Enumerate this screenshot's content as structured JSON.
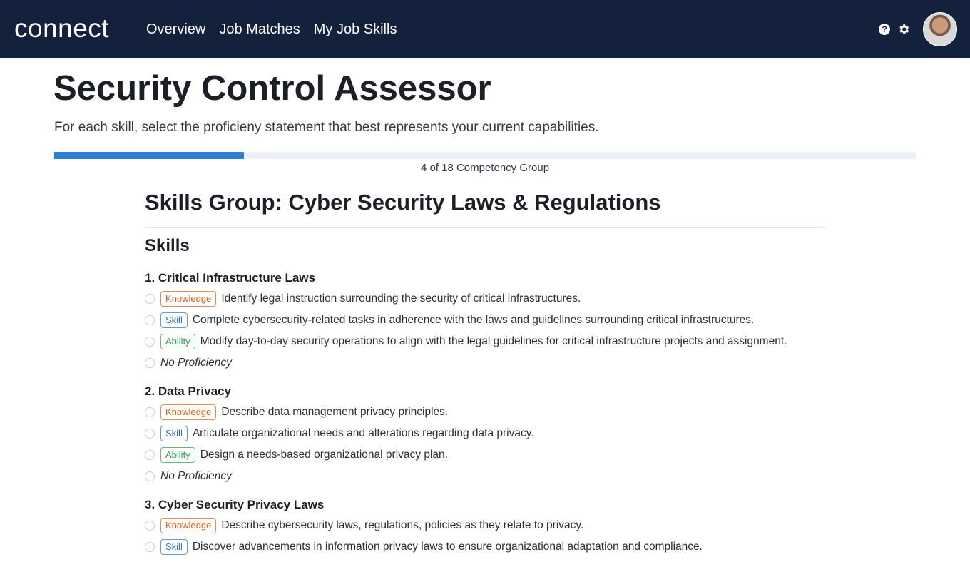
{
  "app": {
    "logo": "connect",
    "nav": [
      "Overview",
      "Job Matches",
      "My Job Skills"
    ],
    "help_icon": "question-circle-icon",
    "settings_icon": "gear-icon"
  },
  "page": {
    "title": "Security Control Assessor",
    "subtitle": "For each skill, select the proficieny statement that best represents your current capabilities.",
    "progress_text": "4 of 18 Competency Group",
    "progress_fraction": 0.22,
    "group_title": "Skills Group: Cyber Security Laws & Regulations",
    "skills_heading": "Skills"
  },
  "colors": {
    "header_bg": "#14213d",
    "progress_fill": "#2f7ed3",
    "knowledge": "#d4651c",
    "skill": "#2b7cc4",
    "ability": "#2f9a53"
  },
  "tags": {
    "knowledge": "Knowledge",
    "skill": "Skill",
    "ability": "Ability"
  },
  "skills": [
    {
      "title": "1. Critical Infrastructure Laws",
      "knowledge": "Identify legal instruction surrounding the security of critical infrastructures.",
      "skill": "Complete cybersecurity-related tasks in adherence with the laws and guidelines surrounding critical infrastructures.",
      "ability": "Modify day-to-day security operations to align with the legal guidelines for critical infrastructure projects and assignment.",
      "none": "No Proficiency"
    },
    {
      "title": "2. Data Privacy",
      "knowledge": "Describe data management privacy principles.",
      "skill": "Articulate organizational needs and alterations regarding data privacy.",
      "ability": "Design a needs-based organizational privacy plan.",
      "none": "No Proficiency"
    },
    {
      "title": "3. Cyber Security Privacy Laws",
      "knowledge": "Describe cybersecurity laws, regulations, policies as they relate to privacy.",
      "skill": "Discover advancements in information privacy laws to ensure organizational adaptation and compliance."
    }
  ]
}
